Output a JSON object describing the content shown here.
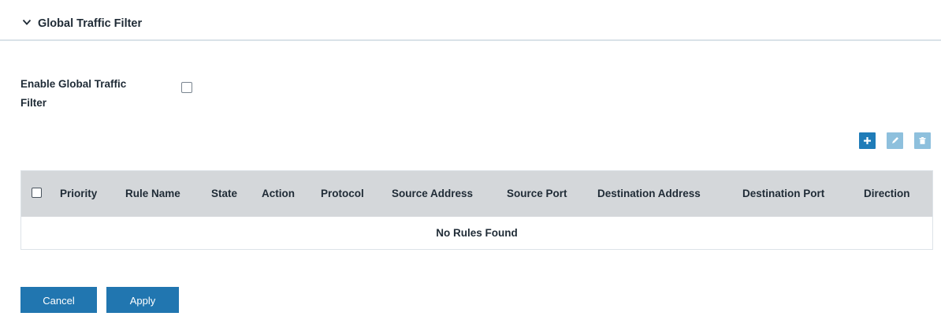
{
  "section": {
    "title": "Global Traffic Filter",
    "icon": "chevron-down-icon"
  },
  "enable": {
    "label": "Enable Global Traffic Filter",
    "checked": false
  },
  "toolbar": {
    "add_icon": "plus-icon",
    "edit_icon": "pencil-icon",
    "delete_icon": "trash-icon",
    "accent": "#1f7cb8",
    "disabled": "#8ec0dd"
  },
  "table": {
    "columns": [
      "Priority",
      "Rule Name",
      "State",
      "Action",
      "Protocol",
      "Source Address",
      "Source Port",
      "Destination Address",
      "Destination Port",
      "Direction"
    ],
    "rows": [],
    "empty_message": "No Rules Found",
    "header_bg": "#d4d7da"
  },
  "buttons": {
    "cancel": "Cancel",
    "apply": "Apply",
    "color": "#2176b0"
  }
}
